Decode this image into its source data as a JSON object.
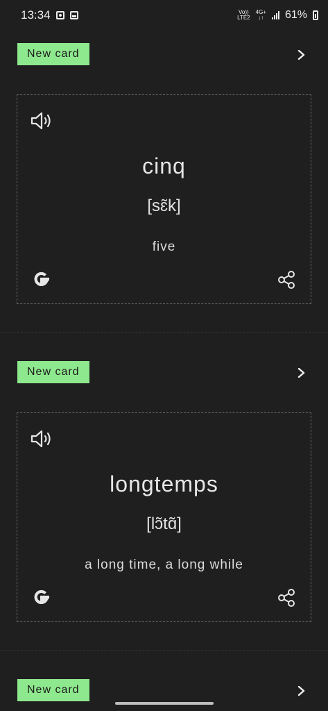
{
  "status_bar": {
    "time": "13:34",
    "network_top": "Vo))",
    "network_bottom": "LTE2",
    "network_gen": "4G+",
    "battery": "61%"
  },
  "cards": [
    {
      "badge": "New card",
      "word": "cinq",
      "phonetic": "[sɛ̃k]",
      "meaning": "five"
    },
    {
      "badge": "New card",
      "word": "longtemps",
      "phonetic": "[lɔ̃tɑ̃]",
      "meaning": "a long time, a long while"
    },
    {
      "badge": "New card"
    }
  ],
  "icons": {
    "speaker": "speaker-icon",
    "google": "google-icon",
    "share": "share-icon",
    "chevron": "chevron-right-icon"
  }
}
